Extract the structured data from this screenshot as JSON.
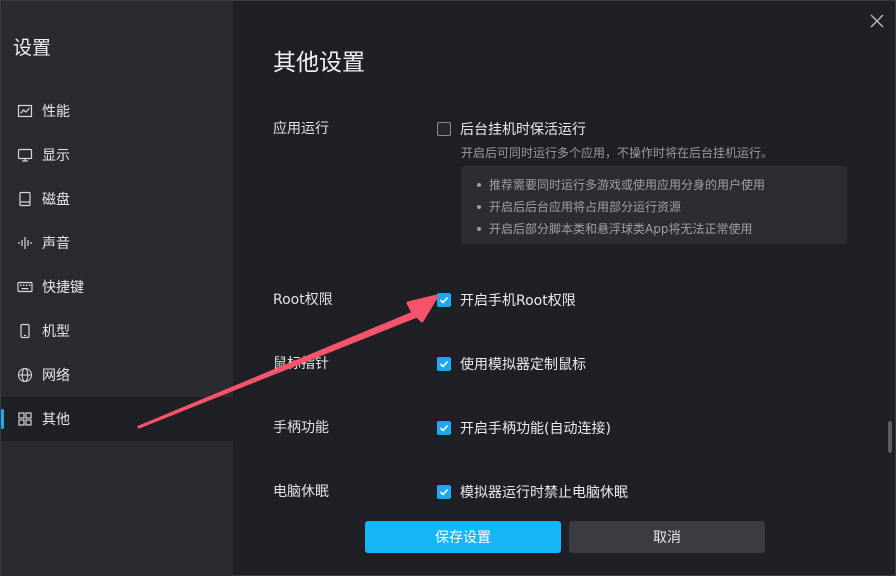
{
  "sidebar": {
    "title": "设置",
    "items": [
      {
        "label": "性能",
        "icon": "performance-chart-icon"
      },
      {
        "label": "显示",
        "icon": "monitor-icon"
      },
      {
        "label": "磁盘",
        "icon": "disk-icon"
      },
      {
        "label": "声音",
        "icon": "sound-wave-icon"
      },
      {
        "label": "快捷键",
        "icon": "keyboard-icon"
      },
      {
        "label": "机型",
        "icon": "phone-icon"
      },
      {
        "label": "网络",
        "icon": "globe-icon"
      },
      {
        "label": "其他",
        "icon": "grid-icon",
        "active": true
      }
    ]
  },
  "main": {
    "title": "其他设置",
    "sections": {
      "app_run": {
        "label": "应用运行",
        "option": "后台挂机时保活运行",
        "checked": false,
        "hint": "开启后可同时运行多个应用，不操作时将在后台挂机运行。",
        "tips": [
          "推荐需要同时运行多游戏或使用应用分身的用户使用",
          "开启后后台应用将占用部分运行资源",
          "开启后部分脚本类和悬浮球类App将无法正常使用"
        ]
      },
      "root": {
        "label": "Root权限",
        "option": "开启手机Root权限",
        "checked": true
      },
      "mouse": {
        "label": "鼠标指针",
        "option": "使用模拟器定制鼠标",
        "checked": true
      },
      "gamepad": {
        "label": "手柄功能",
        "option": "开启手柄功能(自动连接)",
        "checked": true
      },
      "sleep": {
        "label": "电脑休眠",
        "option": "模拟器运行时禁止电脑休眠",
        "checked": true
      }
    }
  },
  "footer": {
    "save_label": "保存设置",
    "cancel_label": "取消"
  },
  "colors": {
    "accent": "#1fa6f3",
    "save_button": "#15b6f7",
    "annotation_arrow": "#f5546a"
  }
}
